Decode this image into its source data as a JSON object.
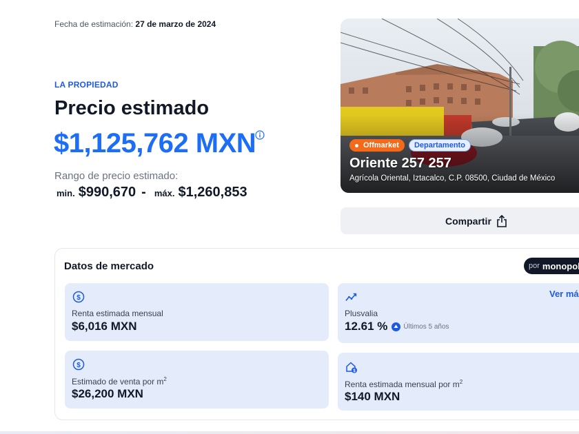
{
  "header": {
    "date_label": "Fecha de estimación:",
    "date_value": "27 de marzo de 2024"
  },
  "property": {
    "section_label": "LA PROPIEDAD",
    "title": "Precio estimado",
    "price": "$1,125,762 MXN",
    "range_label": "Rango de precio estimado:",
    "min_label": "min.",
    "min_value": "$990,670",
    "separator": "-",
    "max_label": "máx.",
    "max_value": "$1,260,853"
  },
  "photo": {
    "badge_offmarket": "Offmarket",
    "badge_type": "Departamento",
    "street": "Oriente 257 257",
    "address": "Agrícola Oriental, Iztacalco, C.P. 08500, Ciudad de México"
  },
  "share": {
    "label": "Compartir"
  },
  "market": {
    "title": "Datos de mercado",
    "por": "por",
    "brand": "monopoli",
    "cards": [
      {
        "label": "Renta estimada mensual",
        "value": "$6,016 MXN",
        "icon": "dollar-circle-icon"
      },
      {
        "label": "Plusvalia",
        "value": "12.61 %",
        "sub": "Últimos 5 años",
        "link": "Ver más",
        "icon": "trend-up-icon"
      },
      {
        "label": "Estimado de venta por m",
        "sup": "2",
        "value": "$26,200 MXN",
        "icon": "dollar-circle-icon"
      },
      {
        "label": "Renta estimada mensual por m",
        "sup": "2",
        "value": "$140 MXN",
        "icon": "house-dollar-icon"
      }
    ]
  },
  "colors": {
    "accent_blue": "#1d6ef5",
    "offmarket_orange": "#f46a1b",
    "card_bg": "#e4ecfb"
  }
}
